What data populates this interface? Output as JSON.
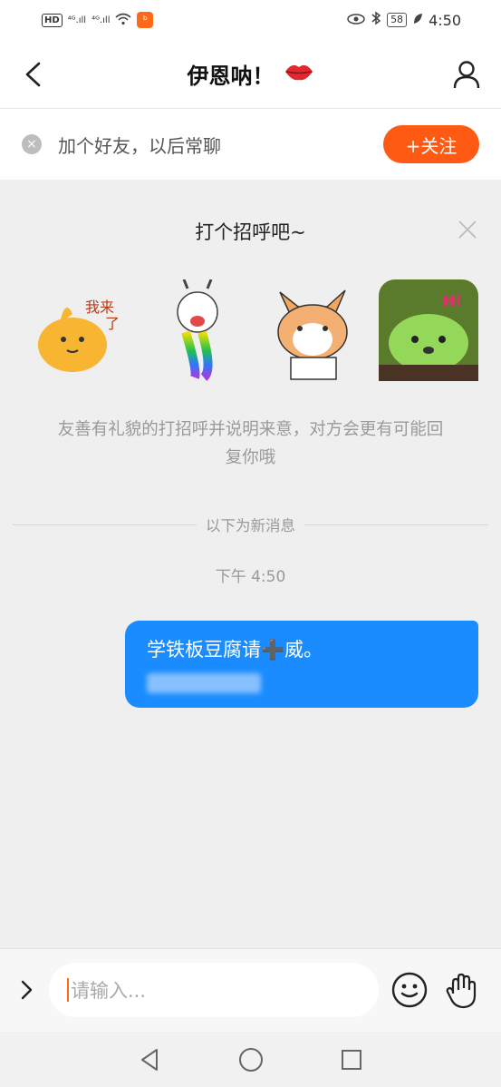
{
  "status_bar": {
    "left": {
      "hd": "HD",
      "sig1": "⁴ᴳ.ıll",
      "sig2": "⁴ᴳ.ıll",
      "wifi": "wifi-icon",
      "app": "ᵇ"
    },
    "battery": "58",
    "time": "4:50"
  },
  "header": {
    "title": "伊恩呐！",
    "title_emoji": "💋",
    "back_icon": "back-chevron-icon",
    "profile_icon": "person-icon"
  },
  "friend_bar": {
    "text": "加个好友，以后常聊",
    "close_icon": "×",
    "follow_label": "+关注"
  },
  "greeting": {
    "title": "打个招呼吧~",
    "close_icon": "close-icon",
    "stickers": [
      {
        "name": "cat-sticker",
        "text": "我来了"
      },
      {
        "name": "rainbow-rabbit-sticker",
        "text": ""
      },
      {
        "name": "corgi-sticker",
        "text": ""
      },
      {
        "name": "green-bear-sticker",
        "text": "Hi"
      }
    ],
    "tip": "友善有礼貌的打招呼并说明来意，对方会更有可能回复你哦"
  },
  "chat": {
    "divider": "以下为新消息",
    "timestamp": "下午 4:50",
    "message": "学铁板豆腐请➕威。"
  },
  "input_bar": {
    "placeholder": "请输入..."
  },
  "colors": {
    "accent": "#ff5a14",
    "bubble": "#1a8cff",
    "background": "#efefef"
  }
}
